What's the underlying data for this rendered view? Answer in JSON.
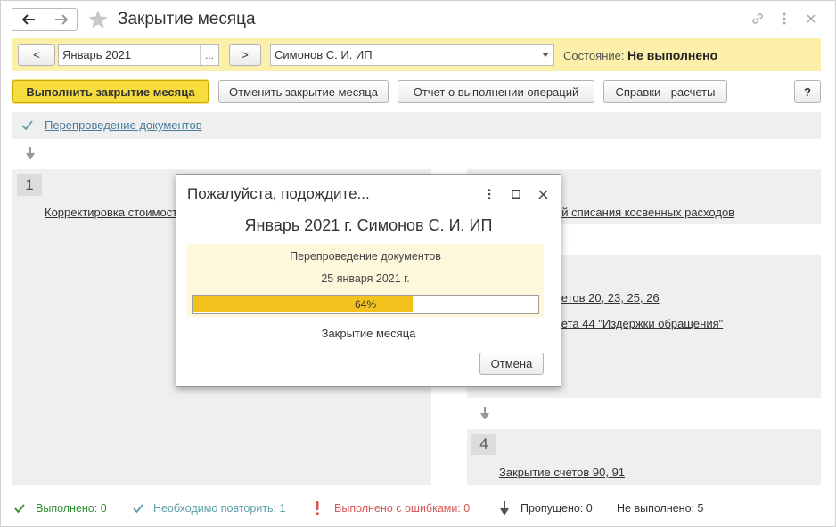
{
  "window": {
    "title": "Закрытие месяца"
  },
  "params": {
    "prev_label": "<",
    "period_value": "Январь 2021",
    "period_pick_label": "...",
    "next_label": ">",
    "org_value": "Симонов С. И. ИП",
    "state_label": "Состояние:",
    "state_value": "Не выполнено"
  },
  "commands": {
    "run_label": "Выполнить закрытие месяца",
    "cancel_label": "Отменить закрытие месяца",
    "report_label": "Отчет о выполнении операций",
    "refs_label": "Справки - расчеты",
    "help_label": "?"
  },
  "content": {
    "repost_link": "Перепроведение документов",
    "step1_num": "1",
    "step1_link": "Корректировка стоимости",
    "step_right1_link": "ей списания косвенных расходов",
    "step_right2_link1": "четов 20, 23, 25, 26",
    "step_right2_link2": "чета 44 \"Издержки обращения\"",
    "step4_num": "4",
    "step4_link": "Закрытие счетов 90, 91"
  },
  "modal": {
    "title": "Пожалуйста, подождите...",
    "subtitle": "Январь 2021 г. Симонов С. И. ИП",
    "operation": "Перепроведение документов",
    "date": "25 января 2021 г.",
    "progress_percent": 64,
    "progress_label": "64%",
    "footer": "Закрытие месяца",
    "cancel_label": "Отмена"
  },
  "status": {
    "done": "Выполнено: 0",
    "repeat": "Необходимо повторить: 1",
    "errors": "Выполнено с ошибками: 0",
    "skipped": "Пропущено:  0",
    "not_done": "Не выполнено:  5"
  },
  "colors": {
    "accent_yellow": "#f6dc3c",
    "param_bar": "#fbefa9",
    "progress_fill": "#f3c21d",
    "ok_green": "#2e8b2e",
    "repeat_teal": "#5a9ea6",
    "error_red": "#d65454"
  }
}
